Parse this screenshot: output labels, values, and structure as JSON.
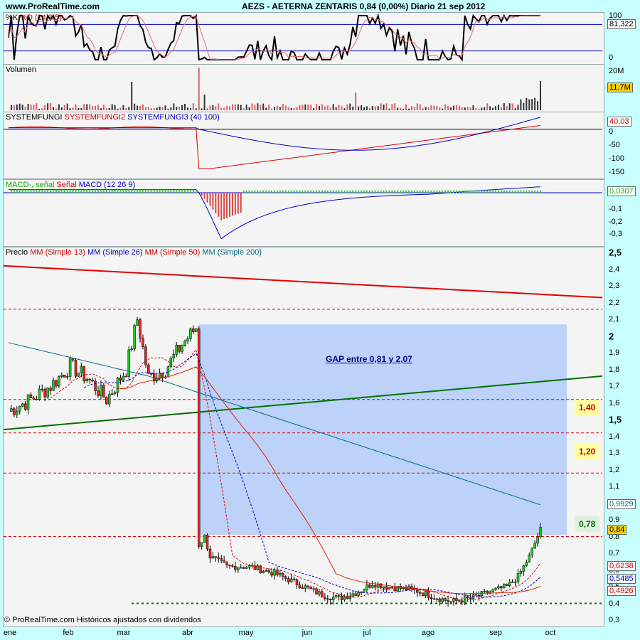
{
  "header": {
    "site": "www.ProRealTime.com",
    "title": "AEZS - AETERNA ZENTARIS    0,84 (0,00%)    Diario  21 sep 2012"
  },
  "stoch": {
    "label_k": "%K",
    "label_d": "%D",
    "label_params": "(14 3 5)",
    "ticks": [
      "100",
      "0"
    ],
    "badge": "81,322"
  },
  "volume": {
    "label": "Volumen",
    "ticks": [
      "20M"
    ],
    "badge": "11,7M"
  },
  "systemfungi": {
    "label_1": "SYSTEMFUNGI",
    "label_2": "SYSTEMFUNGI2",
    "label_3": "SYSTEMFUNGI3 (40 100)",
    "ticks": [
      "0",
      "-50",
      "-100",
      "-150"
    ],
    "badge": "40,03"
  },
  "macd": {
    "label_1": "MACD-,",
    "label_2": "señal",
    "label_3": "Señal",
    "label_4": "MACD (12 26 9)",
    "ticks": [
      "-0,1",
      "-0,2",
      "-0,3"
    ],
    "badge": "0,0307"
  },
  "price": {
    "label_1": "Precio",
    "label_2": "MM (Simple 13)",
    "label_3": "MM (Simple 26)",
    "label_4": "MM (Simple 50)",
    "label_5": "MM (Simple 200)",
    "badges": {
      "mm26": "0,9929",
      "last": "0,84",
      "mm13": "0,6238",
      "mm50": "0,5485",
      "mm200": "0,4926"
    },
    "gap_text": "GAP entre 0,81 y 2,07",
    "annotations": [
      "1,40",
      "1,20",
      "0,78"
    ],
    "copyright": "© ProRealTime.com  Históricos ajustados con dividendos"
  },
  "months": [
    "ene",
    "feb",
    "mar",
    "abr",
    "may",
    "jun",
    "jul",
    "ago",
    "sep",
    "oct"
  ],
  "colors": {
    "background": "#c8ffff",
    "pane": "#f4f4f4",
    "gap_fill": "#bcd2f8",
    "resistance_red": "#e00000",
    "support_green": "#007000",
    "mm200": "#006a80",
    "annotation_fill": "#ffffa0",
    "annotation_green_fill": "#e0f0e0"
  },
  "chart_data": {
    "type": "candlestick",
    "symbol": "AEZS",
    "date": "21 sep 2012",
    "last_close": 0.84,
    "change_pct": 0.0,
    "x_axis": {
      "months": [
        "ene",
        "feb",
        "mar",
        "abr",
        "may",
        "jun",
        "jul",
        "ago",
        "sep",
        "oct"
      ]
    },
    "price_ylim": [
      0.3,
      2.5
    ],
    "price_ticks": [
      2.5,
      2.4,
      2.3,
      2.2,
      2.1,
      2.0,
      1.9,
      1.8,
      1.7,
      1.6,
      1.5,
      1.4,
      1.3,
      1.2,
      1.1,
      1.0,
      0.9,
      0.8,
      0.7,
      0.6,
      0.5,
      0.4,
      0.3
    ],
    "price_tick_labels": [
      "2,5",
      "2,4",
      "2,3",
      "2,2",
      "2,1",
      "2",
      "1,9",
      "1,8",
      "1,7",
      "1,6",
      "1,5",
      "1,4",
      "1,3",
      "1,2",
      "1,1",
      "",
      "0,9",
      "0,8",
      "0,7",
      "0,6",
      "0,5",
      "0,4",
      "0,3"
    ],
    "price_path_monthly": [
      {
        "month": "ene",
        "close": 1.55
      },
      {
        "month": "feb",
        "close": 1.78
      },
      {
        "month": "mar",
        "close": 1.62
      },
      {
        "month": "mar-end",
        "close": 2.0
      },
      {
        "month": "abr",
        "close": 0.72
      },
      {
        "month": "may",
        "close": 0.55
      },
      {
        "month": "jun",
        "close": 0.43
      },
      {
        "month": "jul",
        "close": 0.49
      },
      {
        "month": "ago",
        "close": 0.42
      },
      {
        "month": "sep",
        "close": 0.6
      },
      {
        "month": "sep-end",
        "close": 0.84
      }
    ],
    "gap": {
      "low": 0.81,
      "high": 2.07
    },
    "horizontal_levels": [
      2.16,
      1.62,
      1.42,
      1.18,
      0.8,
      0.4
    ],
    "trendlines": [
      {
        "name": "resistance",
        "from": 2.42,
        "to": 2.23
      },
      {
        "name": "support",
        "from": 1.44,
        "to": 1.76
      }
    ],
    "moving_averages": [
      {
        "name": "MM (Simple 13)",
        "last": 0.6238
      },
      {
        "name": "MM (Simple 26)",
        "last": 0.5485
      },
      {
        "name": "MM (Simple 50)",
        "last": 0.4926
      },
      {
        "name": "MM (Simple 200)",
        "last": 0.9929
      }
    ],
    "stochastic": {
      "k_last": 81.322,
      "ylim": [
        0,
        100
      ]
    },
    "volume": {
      "last": "11,7M",
      "ylim": [
        0,
        20000000
      ]
    },
    "systemfungi": {
      "last": 40.03,
      "ylim": [
        -150,
        50
      ]
    },
    "macd": {
      "last": 0.0307,
      "ylim": [
        -0.3,
        0.05
      ]
    }
  }
}
